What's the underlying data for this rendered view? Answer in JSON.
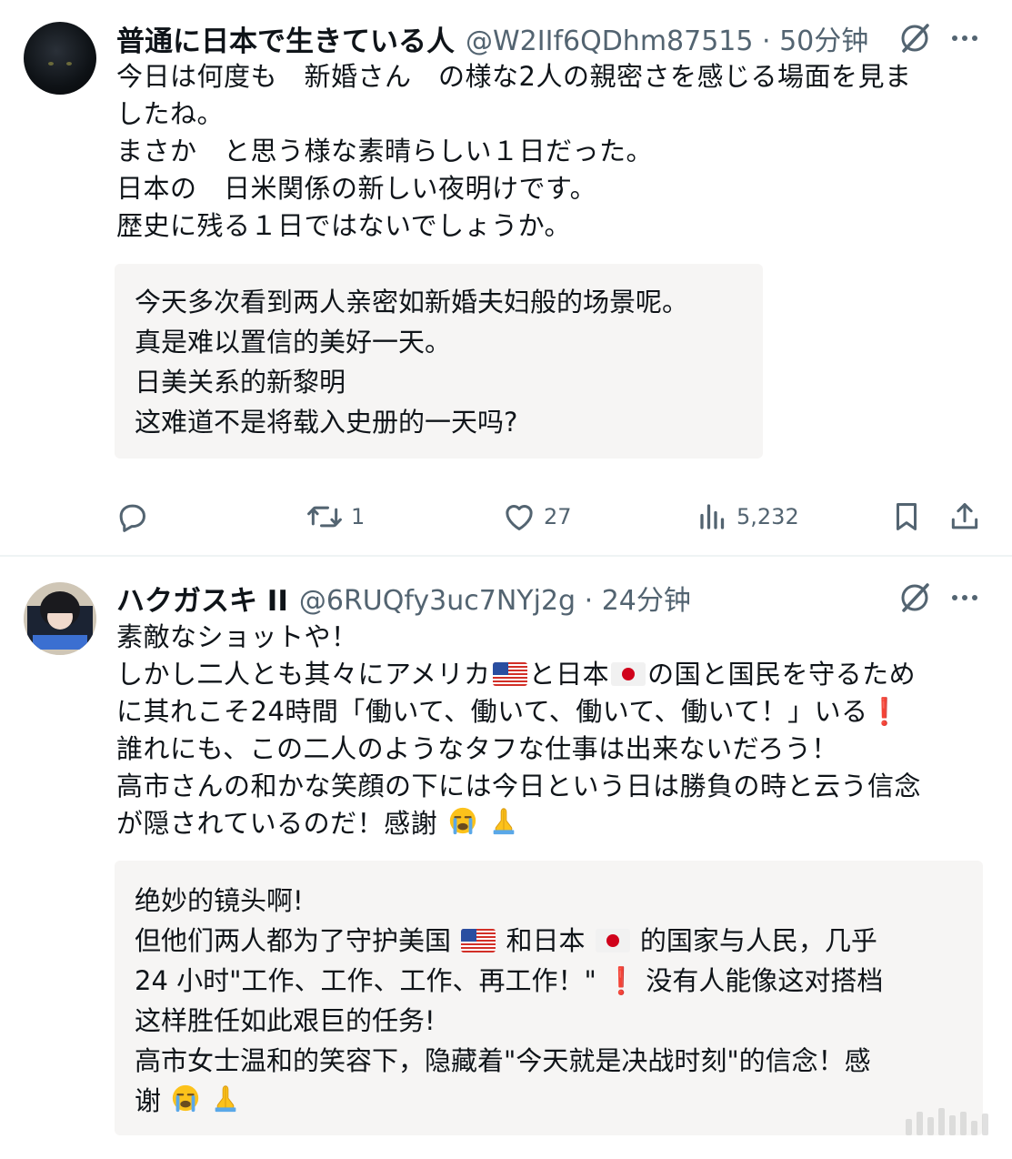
{
  "posts": [
    {
      "name": "普通に日本で生きている人",
      "handle": "@W2IIf6QDhm87515 · 50分钟",
      "lines": [
        "今日は何度も　新婚さん　の様な2人の親密さを感じる場面を見ま",
        "したね。",
        "まさか　と思う様な素晴らしい１日だった。",
        "日本の　日米関係の新しい夜明けです。",
        "歴史に残る１日ではないでしょうか。"
      ],
      "translation": [
        "今天多次看到两人亲密如新婚夫妇般的场景呢。",
        "真是难以置信的美好一天。",
        "日美关系的新黎明",
        "这难道不是将载入史册的一天吗?"
      ],
      "actions": {
        "reply_count": "",
        "repost_count": "1",
        "like_count": "27",
        "view_count": "5,232"
      }
    },
    {
      "name": "ハクガスキ II",
      "handle": "@6RUQfy3uc7NYj2g · 24分钟",
      "lines": {
        "l1": "素敵なショットや！",
        "l2a": "しかし二人とも其々にアメリカ",
        "l2b": "と日本",
        "l2c": "の国と国民を守るため",
        "l3a": "に其れこそ24時間「働いて、働いて、働いて、働いて！」いる",
        "l4": "誰れにも、この二人のようなタフな仕事は出来ないだろう！",
        "l5": "高市さんの和かな笑顔の下には今日という日は勝負の時と云う信念",
        "l6": "が隠されているのだ！感謝"
      },
      "translation": {
        "t1": "绝妙的镜头啊!",
        "t2a": "但他们两人都为了守护美国",
        "t2b": "和日本",
        "t2c": "的国家与人民，几乎",
        "t3a": "24 小时\"工作、工作、工作、再工作！\"",
        "t3b": "没有人能像这对搭档",
        "t4": "这样胜任如此艰巨的任务!",
        "t5": "高市女士温和的笑容下，隐藏着\"今天就是决战时刻\"的信念！感",
        "t6": "谢"
      }
    }
  ],
  "icons": {
    "grok": "grok-slash-icon",
    "more": "more-options-icon",
    "reply": "reply-icon",
    "repost": "repost-icon",
    "like": "heart-icon",
    "views": "analytics-icon",
    "bookmark": "bookmark-icon",
    "share": "share-icon",
    "emoji_cry": "loudly-crying-face",
    "emoji_pray": "folded-hands",
    "flag_us": "us-flag",
    "flag_jp": "japan-flag",
    "exclamation": "red-exclamation-mark"
  },
  "colors": {
    "text": "#0f1419",
    "secondary": "#536471",
    "translation_bg": "#f6f5f4",
    "divider": "#eff3f4"
  }
}
